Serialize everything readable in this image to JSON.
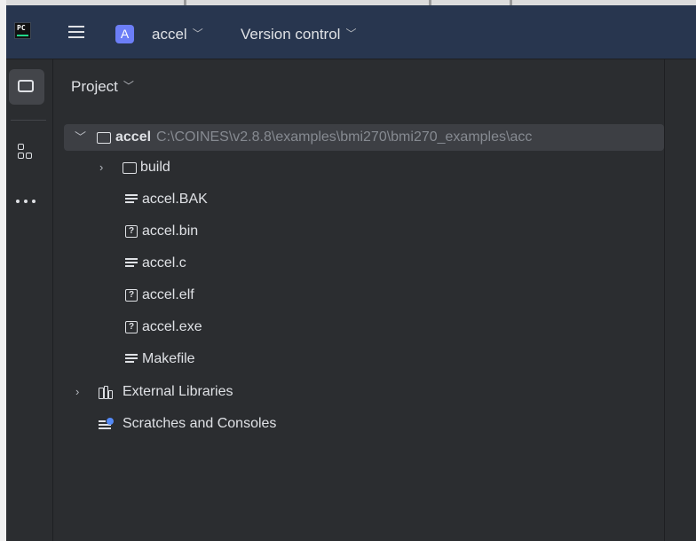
{
  "header": {
    "app_icon_text": "PC",
    "project_badge": "A",
    "project_name": "accel",
    "vcs_label": "Version control"
  },
  "toolstrip": {
    "items": [
      "project-folder-icon",
      "structure-icon",
      "more-icon"
    ]
  },
  "panel": {
    "title": "Project"
  },
  "tree": {
    "root": {
      "name": "accel",
      "path": "C:\\COINES\\v2.8.8\\examples\\bmi270\\bmi270_examples\\acc"
    },
    "items": [
      {
        "name": "build",
        "icon": "folder-icon"
      },
      {
        "name": "accel.BAK",
        "icon": "text-file-icon"
      },
      {
        "name": "accel.bin",
        "icon": "unknown-file-icon"
      },
      {
        "name": "accel.c",
        "icon": "text-file-icon"
      },
      {
        "name": "accel.elf",
        "icon": "unknown-file-icon"
      },
      {
        "name": "accel.exe",
        "icon": "unknown-file-icon"
      },
      {
        "name": "Makefile",
        "icon": "text-file-icon"
      }
    ],
    "external_libraries": "External Libraries",
    "scratches": "Scratches and Consoles"
  },
  "colors": {
    "header_bg": "#28364f",
    "panel_bg": "#2b2d30",
    "selection_bg": "#3d3f44",
    "badge": "#6c7ef7",
    "path_text": "#868a91"
  }
}
